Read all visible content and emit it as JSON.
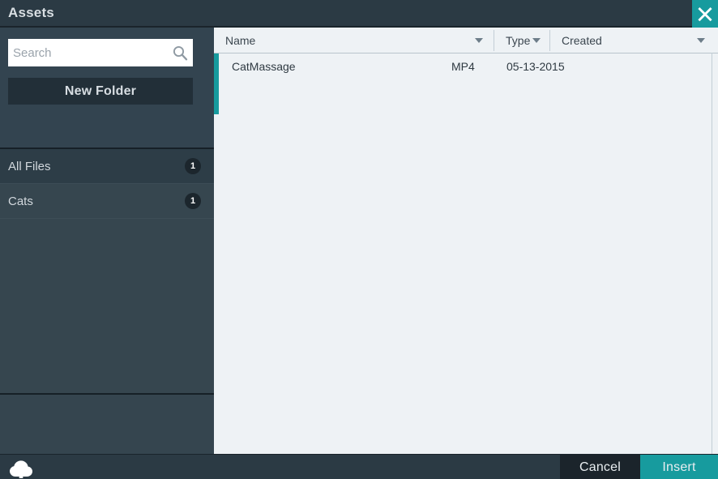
{
  "window": {
    "title": "Assets",
    "close_icon": "close-icon",
    "accent_color": "#179b9e",
    "titlebar_color": "#2b3a44",
    "sidebar_color": "#334450",
    "content_color": "#eef2f5"
  },
  "sidebar": {
    "search": {
      "placeholder": "Search",
      "value": "",
      "icon": "search-icon"
    },
    "new_folder_label": "New Folder",
    "folders": [
      {
        "label": "All Files",
        "count": "1",
        "selected": true
      },
      {
        "label": "Cats",
        "count": "1",
        "selected": false
      }
    ]
  },
  "file_table": {
    "columns": [
      {
        "label": "Name",
        "sort_icon": "chevron-down-icon"
      },
      {
        "label": "Type",
        "sort_icon": "chevron-down-icon"
      },
      {
        "label": "Created",
        "sort_icon": "chevron-down-icon"
      }
    ],
    "rows": [
      {
        "name": "CatMassage",
        "type": "MP4",
        "created": "05-13-2015"
      }
    ]
  },
  "footer": {
    "upload_icon": "cloud-upload-icon",
    "cancel_label": "Cancel",
    "insert_label": "Insert"
  }
}
